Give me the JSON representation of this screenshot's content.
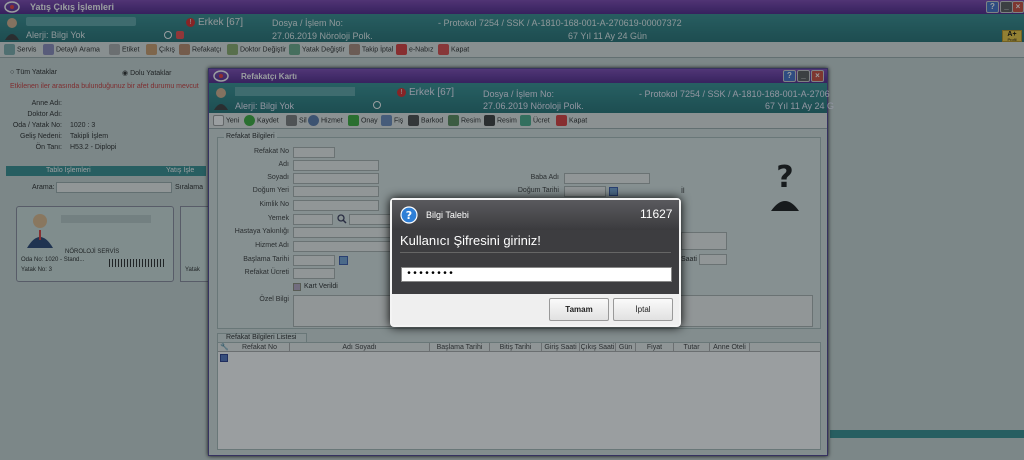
{
  "main": {
    "title": "Yatış Çıkış İşlemleri",
    "patient": {
      "allergy": "Alerji: Bilgi Yok",
      "gender_age": "Erkek [67]",
      "dosya_label": "Dosya / İşlem No:",
      "date_dept": "27.06.2019 Nöroloji Polk.",
      "protokol": "- Protokol  7254 / SSK / A-1810-168-001-A-270619-00007372",
      "age_long": "67 Yıl 11 Ay 24 Gün",
      "badge": "A+",
      "badge_sub": "Profil"
    },
    "toolbar": [
      "Servis",
      "Detaylı Arama",
      "Etiket",
      "Çıkış",
      "Refakatçı",
      "Doktor Değiştir",
      "Yatak Değiştir",
      "Takip İptal",
      "e-Nabız",
      "Kapat"
    ],
    "filters": {
      "all": "Tüm Yataklar",
      "full": "Dolu Yataklar"
    },
    "warning": "Etkilenen iler arasında bulunduğunuz bir afet durumu mevcut",
    "details": [
      {
        "label": "Anne Adı:",
        "value": ""
      },
      {
        "label": "Doktor Adı:",
        "value": ""
      },
      {
        "label": "Oda / Yatak No:",
        "value": "1020 : 3"
      },
      {
        "label": "Geliş Nedeni:",
        "value": "Takipli İşlem"
      },
      {
        "label": "Ön Tanı:",
        "value": "H53.2 - Diplopi"
      }
    ],
    "tabs": [
      "Tablo İşlemleri",
      "Yatış İşle"
    ],
    "search_label": "Arama:",
    "sort_label": "Sıralama",
    "card": {
      "service": "NÖROLOJİ SERVİS",
      "room": "Oda No: 1020 - Stand...",
      "bed": "Yatak No: 3",
      "bed2": "Yatak"
    }
  },
  "child": {
    "title": "Refakatçı Kartı",
    "patient": {
      "allergy": "Alerji: Bilgi Yok",
      "gender_age": "Erkek [67]",
      "dosya_label": "Dosya / İşlem No:",
      "date_dept": "27.06.2019 Nöroloji Polk.",
      "protokol": "- Protokol  7254 / SSK / A-1810-168-001-A-2706",
      "age_long": "67 Yıl 11 Ay 24 G"
    },
    "toolbar": [
      "Yeni",
      "Kaydet",
      "Sil",
      "Hizmet",
      "Onay",
      "Fiş",
      "Barkod",
      "Resim",
      "Resim",
      "Ücret",
      "Kapat"
    ],
    "section_title": "Refakat Bilgileri",
    "left_fields": [
      "Refakat No",
      "Adı",
      "Soyadı",
      "Doğum Yeri",
      "Kimlik No",
      "Yemek",
      "Hastaya Yakınlığı",
      "Hizmet Adı",
      "Başlama Tarihi",
      "Refakat Ücreti"
    ],
    "right_fields": [
      "Baba Adı",
      "Doğum Tarihi"
    ],
    "right_extra": [
      "İl",
      "Saati"
    ],
    "kart_verildi": "Kart Verildi",
    "ozel_bilgi": "Özel Bilgi",
    "list_title": "Refakat Bilgileri Listesi",
    "columns": [
      "Refakat No",
      "Adı Soyadı",
      "Başlama Tarihi",
      "Bitiş Tarihi",
      "Giriş Saati",
      "Çıkış Saati",
      "Gün",
      "Fiyat",
      "Tutar",
      "Anne Oteli"
    ]
  },
  "dialog": {
    "title": "Bilgi Talebi",
    "code": "11627",
    "message": "Kullanıcı Şifresini giriniz!",
    "password_value": "••••••••",
    "ok_label": "Tamam",
    "cancel_label": "İptal"
  }
}
